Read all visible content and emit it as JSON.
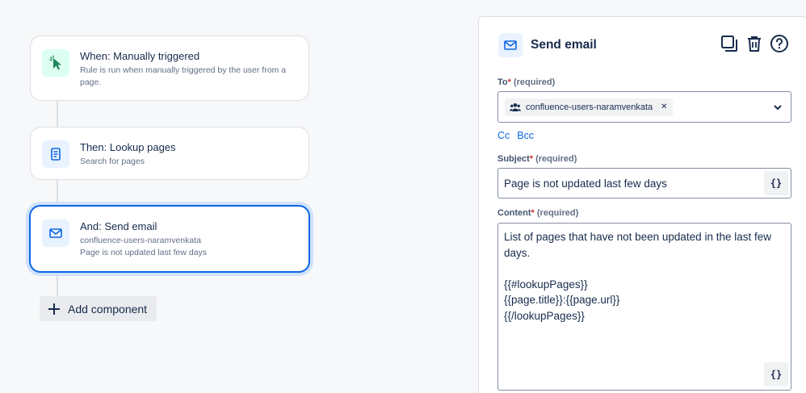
{
  "flow": {
    "trigger": {
      "title": "When: Manually triggered",
      "subtitle": "Rule is run when manually triggered by the user from a page.",
      "icon": "cursor-click-icon"
    },
    "action": {
      "title": "Then: Lookup pages",
      "subtitle": "Search for pages",
      "icon": "document-icon"
    },
    "email": {
      "title": "And: Send email",
      "line1": "confluence-users-naramvenkata",
      "line2": "Page is not updated last few days",
      "icon": "envelope-icon"
    },
    "add_component_label": "Add component"
  },
  "panel": {
    "title": "Send email",
    "to": {
      "label": "To",
      "required_text": "(required)",
      "chip": "confluence-users-naramvenkata"
    },
    "cc_label": "Cc",
    "bcc_label": "Bcc",
    "subject": {
      "label": "Subject",
      "required_text": "(required)",
      "value": "Page is not updated last few days"
    },
    "content": {
      "label": "Content",
      "required_text": "(required)",
      "value": "List of pages that have not been updated in the last few days.\n\n{{#lookupPages}}\n{{page.title}}:{{page.url}}\n{{/lookupPages}}"
    },
    "smart_value_label": "{}"
  },
  "colors": {
    "accent": "#0c66e4",
    "success": "#1f845a",
    "required": "#c9372c"
  }
}
